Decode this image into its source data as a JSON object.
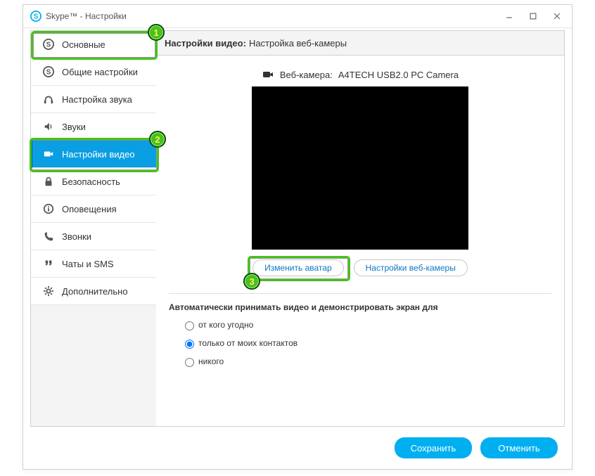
{
  "window": {
    "title": "Skype™ - Настройки"
  },
  "sidebar": {
    "items": [
      {
        "id": "general",
        "label": "Основные",
        "icon": "skype"
      },
      {
        "id": "common",
        "label": "Общие настройки",
        "icon": "skype"
      },
      {
        "id": "audio",
        "label": "Настройка звука",
        "icon": "headset"
      },
      {
        "id": "sounds",
        "label": "Звуки",
        "icon": "speaker"
      },
      {
        "id": "video",
        "label": "Настройки видео",
        "icon": "camera"
      },
      {
        "id": "security",
        "label": "Безопасность",
        "icon": "lock"
      },
      {
        "id": "notifications",
        "label": "Оповещения",
        "icon": "info"
      },
      {
        "id": "calls",
        "label": "Звонки",
        "icon": "phone"
      },
      {
        "id": "chats",
        "label": "Чаты и SMS",
        "icon": "quote"
      },
      {
        "id": "advanced",
        "label": "Дополнительно",
        "icon": "gear"
      }
    ],
    "active_id": "video"
  },
  "header": {
    "bold": "Настройки видео:",
    "rest": "Настройка веб-камеры"
  },
  "camera": {
    "label": "Веб-камера:",
    "value": "A4TECH USB2.0 PC Camera"
  },
  "buttons": {
    "change_avatar": "Изменить аватар",
    "webcam_settings": "Настройки веб-камеры"
  },
  "auto_accept": {
    "label": "Автоматически принимать видео и демонстрировать экран для",
    "options": [
      {
        "id": "anyone",
        "label": "от кого угодно"
      },
      {
        "id": "contacts",
        "label": "только от моих контактов"
      },
      {
        "id": "nobody",
        "label": "никого"
      }
    ],
    "selected": "contacts"
  },
  "footer": {
    "save": "Сохранить",
    "cancel": "Отменить"
  },
  "annotations": {
    "1": "1",
    "2": "2",
    "3": "3"
  }
}
